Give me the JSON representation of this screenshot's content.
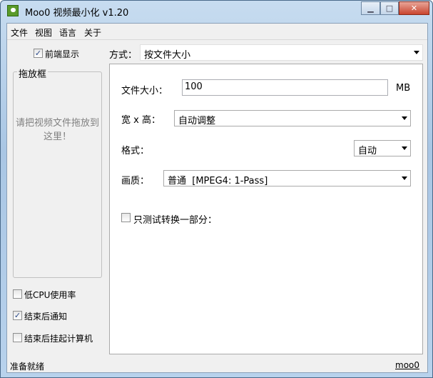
{
  "window": {
    "title": "Moo0 视频最小化 v1.20"
  },
  "menu": [
    "文件",
    "视图",
    "语言",
    "关于"
  ],
  "left": {
    "topmost_label": "前端显示",
    "topmost_checked": true,
    "group_label": "拖放框",
    "drop_hint": "请把视频文件拖放到这里！",
    "options": [
      {
        "label": "低CPU使用率",
        "checked": false
      },
      {
        "label": "结束后通知",
        "checked": true
      },
      {
        "label": "结束后挂起计算机",
        "checked": false
      }
    ]
  },
  "mode": {
    "label": "方式：",
    "value": "按文件大小"
  },
  "panel": {
    "size_label": "文件大小：",
    "size_value": "100",
    "size_unit": "MB",
    "dim_label": "宽 x 高：",
    "dim_value": "自动调整",
    "format_label": "格式：",
    "format_value": "自动",
    "quality_label": "画质：",
    "quality_value": "普通  [MPEG4: 1-Pass]",
    "partial_label": "只测试转换一部分：",
    "partial_checked": false
  },
  "status": {
    "text": "准备就绪",
    "link": "moo0"
  }
}
